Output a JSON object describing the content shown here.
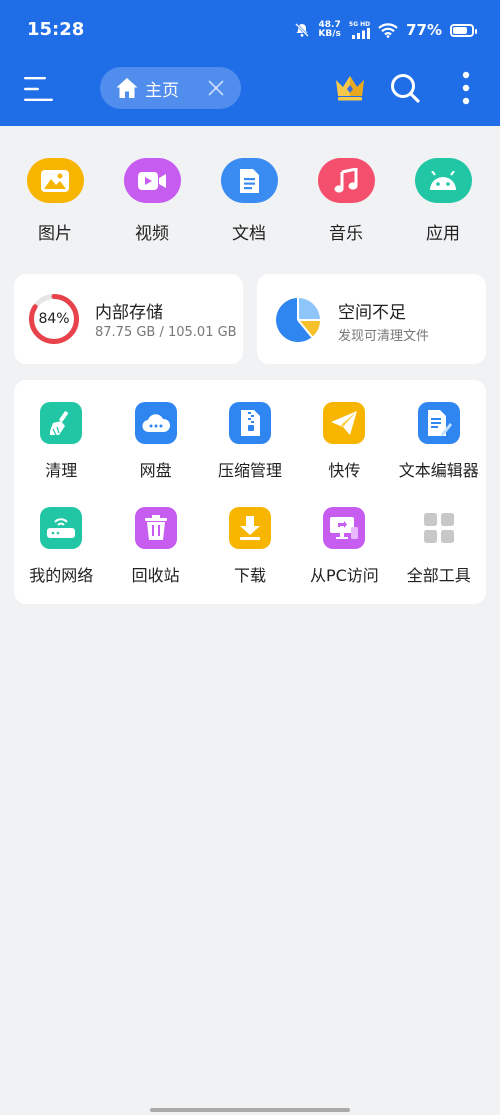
{
  "status_bar": {
    "time": "15:28",
    "net_speed_value": "48.7",
    "net_speed_unit": "KB/s",
    "signal_label": "5G HD",
    "battery_percent": "77%",
    "battery_level": 0.77
  },
  "header": {
    "home_tab_label": "主页"
  },
  "categories": [
    {
      "name": "图片",
      "icon": "image-icon",
      "color": "#f7b500"
    },
    {
      "name": "视频",
      "icon": "video-icon",
      "color": "#c75cf0"
    },
    {
      "name": "文档",
      "icon": "document-icon",
      "color": "#3a8cf2"
    },
    {
      "name": "音乐",
      "icon": "music-icon",
      "color": "#f4506e"
    },
    {
      "name": "应用",
      "icon": "android-icon",
      "color": "#21c7a5"
    }
  ],
  "storage": {
    "percent_label": "84%",
    "percent": 84,
    "title": "内部存储",
    "usage": "87.75 GB / 105.01 GB"
  },
  "space_card": {
    "title": "空间不足",
    "subtitle": "发现可清理文件"
  },
  "tools": [
    {
      "name": "清理",
      "icon": "broom-icon",
      "color": "#21c7a5"
    },
    {
      "name": "网盘",
      "icon": "cloud-icon",
      "color": "#2f86f0"
    },
    {
      "name": "压缩管理",
      "icon": "zip-icon",
      "color": "#2f86f0"
    },
    {
      "name": "快传",
      "icon": "paper-plane-icon",
      "color": "#f7b500"
    },
    {
      "name": "文本编辑器",
      "icon": "text-editor-icon",
      "color": "#2f86f0"
    },
    {
      "name": "我的网络",
      "icon": "router-icon",
      "color": "#21c7a5"
    },
    {
      "name": "回收站",
      "icon": "trash-icon",
      "color": "#c75cf0"
    },
    {
      "name": "下载",
      "icon": "download-icon",
      "color": "#f7b500"
    },
    {
      "name": "从PC访问",
      "icon": "pc-access-icon",
      "color": "#c75cf0"
    },
    {
      "name": "全部工具",
      "icon": "all-tools-icon",
      "color": "#c8c8c8"
    }
  ]
}
